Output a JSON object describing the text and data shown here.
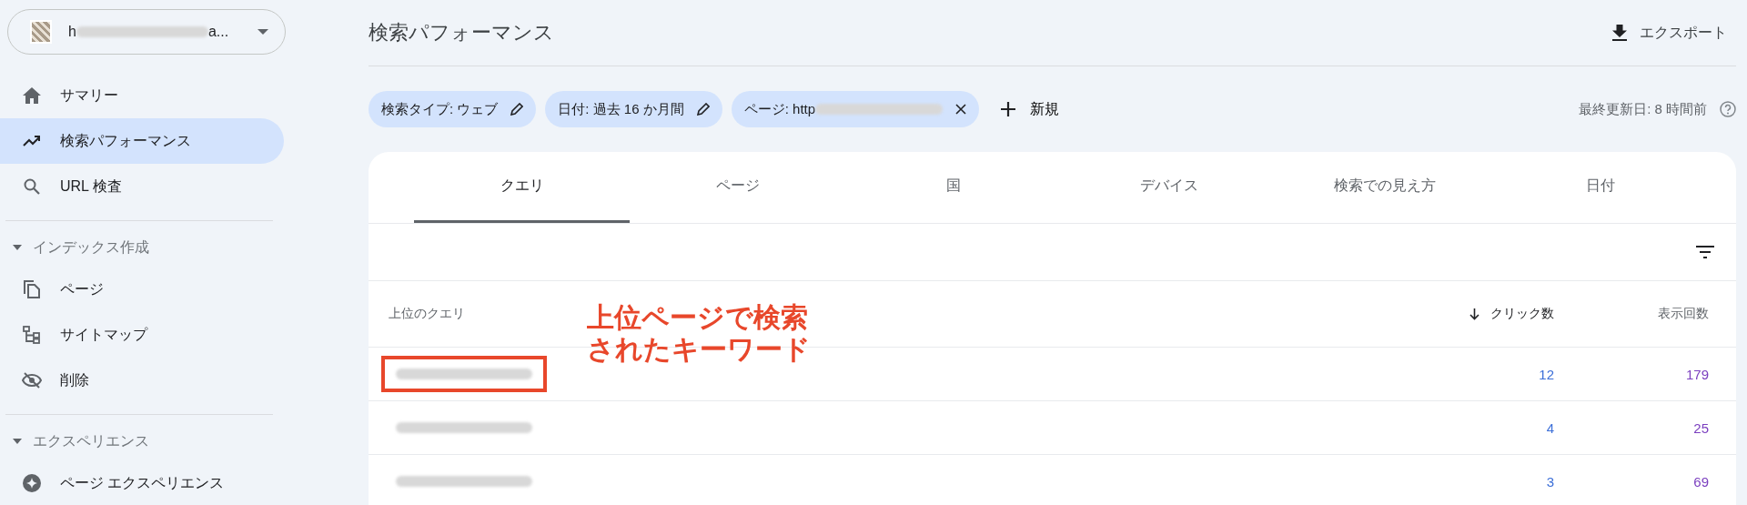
{
  "property": {
    "prefix": "h",
    "suffix": "a..."
  },
  "nav": [
    {
      "kind": "home",
      "label": "サマリー",
      "selected": false
    },
    {
      "kind": "trend",
      "label": "検索パフォーマンス",
      "selected": true
    },
    {
      "kind": "search",
      "label": "URL 検査",
      "selected": false
    },
    {
      "kind": "section",
      "label": "インデックス作成",
      "expanded": true
    },
    {
      "kind": "pages",
      "label": "ページ",
      "selected": false
    },
    {
      "kind": "sitemap",
      "label": "サイトマップ",
      "selected": false
    },
    {
      "kind": "eyeoff",
      "label": "削除",
      "selected": false
    },
    {
      "kind": "section",
      "label": "エクスペリエンス",
      "expanded": true
    },
    {
      "kind": "star",
      "label": "ページ エクスペリエンス",
      "selected": false
    }
  ],
  "title": "検索パフォーマンス",
  "export": "エクスポート",
  "chips": [
    {
      "kind": "edit",
      "label": "検索タイプ: ウェブ",
      "redacted": false
    },
    {
      "kind": "edit",
      "label": "日付: 過去 16 か月間",
      "redacted": false
    },
    {
      "kind": "remove",
      "label": "ページ: http",
      "redacted": true
    }
  ],
  "new_button": "新規",
  "last_updated": "最終更新日: 8 時間前",
  "tabs": [
    {
      "label": "クエリ",
      "selected": true
    },
    {
      "label": "ページ",
      "selected": false
    },
    {
      "label": "国",
      "selected": false
    },
    {
      "label": "デバイス",
      "selected": false
    },
    {
      "label": "検索での見え方",
      "selected": false
    },
    {
      "label": "日付",
      "selected": false
    }
  ],
  "table": {
    "columns": [
      {
        "label": "上位のクエリ",
        "sorted": false
      },
      {
        "label": "クリック数",
        "sorted": true
      },
      {
        "label": "表示回数",
        "sorted": false
      }
    ],
    "rows": [
      {
        "clicks": "12",
        "impressions": "179",
        "highlighted": true
      },
      {
        "clicks": "4",
        "impressions": "25",
        "highlighted": false
      },
      {
        "clicks": "3",
        "impressions": "69",
        "highlighted": false
      }
    ]
  },
  "annotation": [
    "上位ページで検索",
    "されたキーワード"
  ]
}
